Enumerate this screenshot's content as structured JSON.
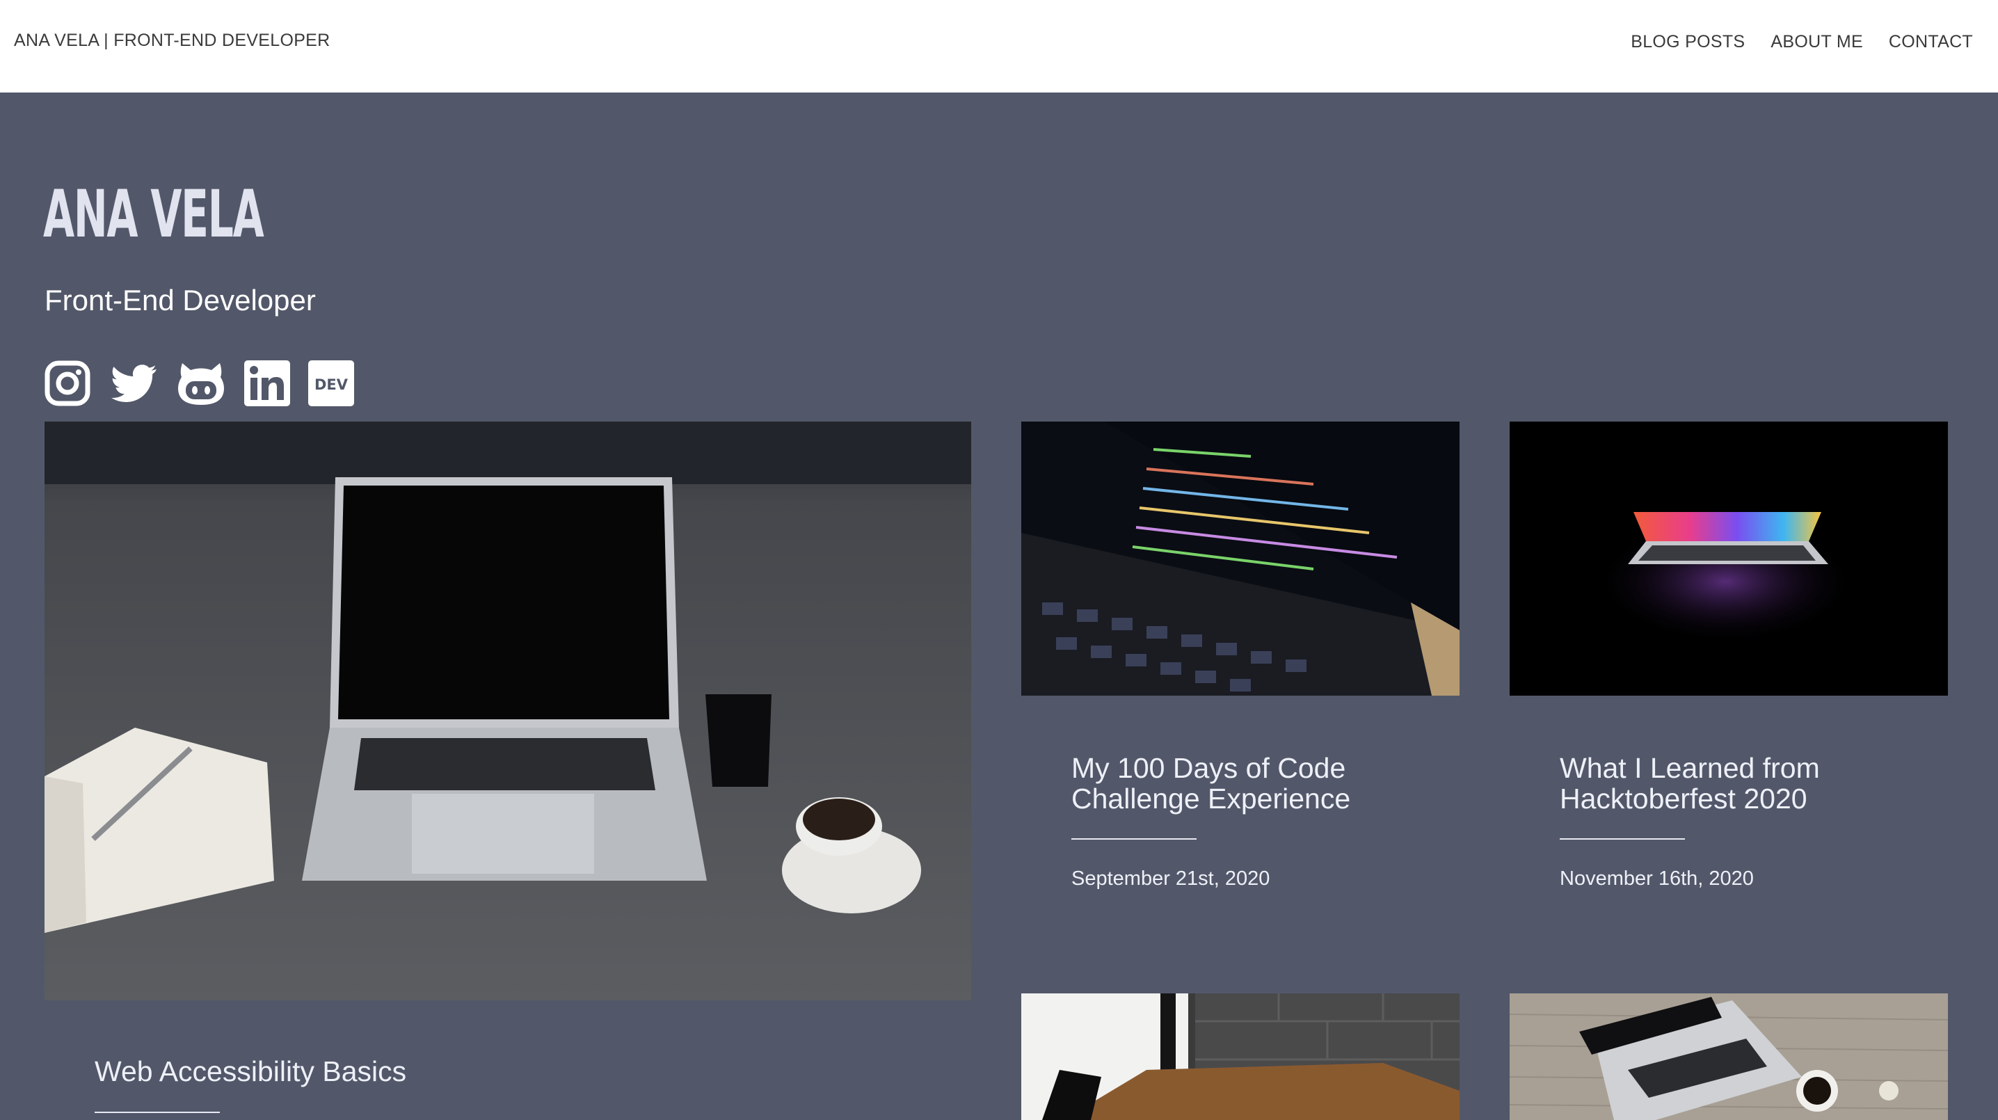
{
  "header": {
    "brand": "ANA VELA | FRONT-END DEVELOPER",
    "nav": [
      "BLOG POSTS",
      "ABOUT ME",
      "CONTACT"
    ]
  },
  "hero": {
    "name": "ANA VELA",
    "role": "Front-End Developer",
    "social_icons": [
      "instagram-icon",
      "twitter-icon",
      "github-icon",
      "linkedin-icon",
      "dev-icon"
    ],
    "dev_badge_text": "DEV"
  },
  "posts": [
    {
      "title": "Web Accessibility Basics"
    },
    {
      "title_line1": "My 100 Days of Code",
      "title_line2": "Challenge Experience",
      "date": "September 21st, 2020"
    },
    {
      "title_line1": "What I Learned from",
      "title_line2": "Hacktoberfest 2020",
      "date": "November 16th, 2020"
    }
  ],
  "colors": {
    "page_background": "#525869",
    "header_background": "#ffffff",
    "heading_text": "#e1e3ef"
  }
}
